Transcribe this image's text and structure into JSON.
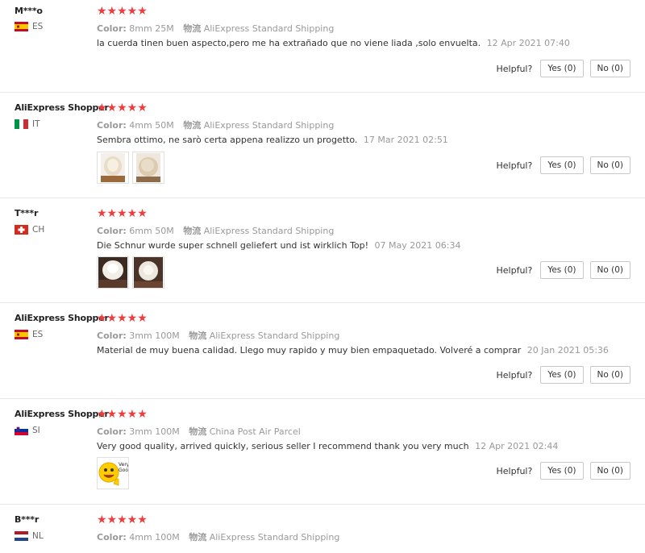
{
  "helpful_label": "Helpful?",
  "colors": {
    "star": "#f03c3c",
    "muted": "#999999",
    "border": "#e8e8e8"
  },
  "reviews": [
    {
      "name": "M***o",
      "country": "ES",
      "flag": "spain-flag-icon",
      "rating": 5,
      "color_label": "Color:",
      "color_value": "8mm 25M",
      "ship_label": "物流",
      "ship_value": "AliExpress Standard Shipping",
      "text": "la cuerda tinen buen aspecto,pero me ha extrañado que no viene liada ,solo envuelta.",
      "date": "12 Apr 2021 07:40",
      "photos": [],
      "yes": "Yes (0)",
      "no": "No (0)"
    },
    {
      "name": "AliExpress Shopper",
      "country": "IT",
      "flag": "italy-flag-icon",
      "rating": 5,
      "color_label": "Color:",
      "color_value": "4mm 50M",
      "ship_label": "物流",
      "ship_value": "AliExpress Standard Shipping",
      "text": "Sembra ottimo, ne sarò certa appena realizzo un progetto.",
      "date": "17 Mar 2021 02:51",
      "photos": [
        "cord-photo-1",
        "cord-photo-2"
      ],
      "yes": "Yes (0)",
      "no": "No (0)"
    },
    {
      "name": "T***r",
      "country": "CH",
      "flag": "switzerland-flag-icon",
      "rating": 5,
      "color_label": "Color:",
      "color_value": "6mm 50M",
      "ship_label": "物流",
      "ship_value": "AliExpress Standard Shipping",
      "text": "Die Schnur wurde super schnell geliefert und ist wirklich Top!",
      "date": "07 May 2021 06:34",
      "photos": [
        "cord-photo-1",
        "cord-photo-2"
      ],
      "yes": "Yes (0)",
      "no": "No (0)"
    },
    {
      "name": "AliExpress Shopper",
      "country": "ES",
      "flag": "spain-flag-icon",
      "rating": 5,
      "color_label": "Color:",
      "color_value": "3mm 100M",
      "ship_label": "物流",
      "ship_value": "AliExpress Standard Shipping",
      "text": "Material de muy buena calidad. Llego muy rapido y muy bien empaquetado. Volveré a comprar",
      "date": "20 Jan 2021 05:36",
      "photos": [],
      "yes": "Yes (0)",
      "no": "No (0)"
    },
    {
      "name": "AliExpress Shopper",
      "country": "SI",
      "flag": "slovenia-flag-icon",
      "rating": 5,
      "color_label": "Color:",
      "color_value": "3mm 100M",
      "ship_label": "物流",
      "ship_value": "China Post Air Parcel",
      "text": "Very good quality, arrived quickly, serious seller I recommend thank you very much",
      "date": "12 Apr 2021 02:44",
      "photos": [
        "very-good-emoji"
      ],
      "photo_caption": "Very Good",
      "yes": "Yes (0)",
      "no": "No (0)"
    },
    {
      "name": "B***r",
      "country": "NL",
      "flag": "netherlands-flag-icon",
      "rating": 5,
      "color_label": "Color:",
      "color_value": "4mm 100M",
      "ship_label": "物流",
      "ship_value": "AliExpress Standard Shipping",
      "text": "",
      "date": "",
      "photos": [],
      "yes": "",
      "no": ""
    }
  ]
}
